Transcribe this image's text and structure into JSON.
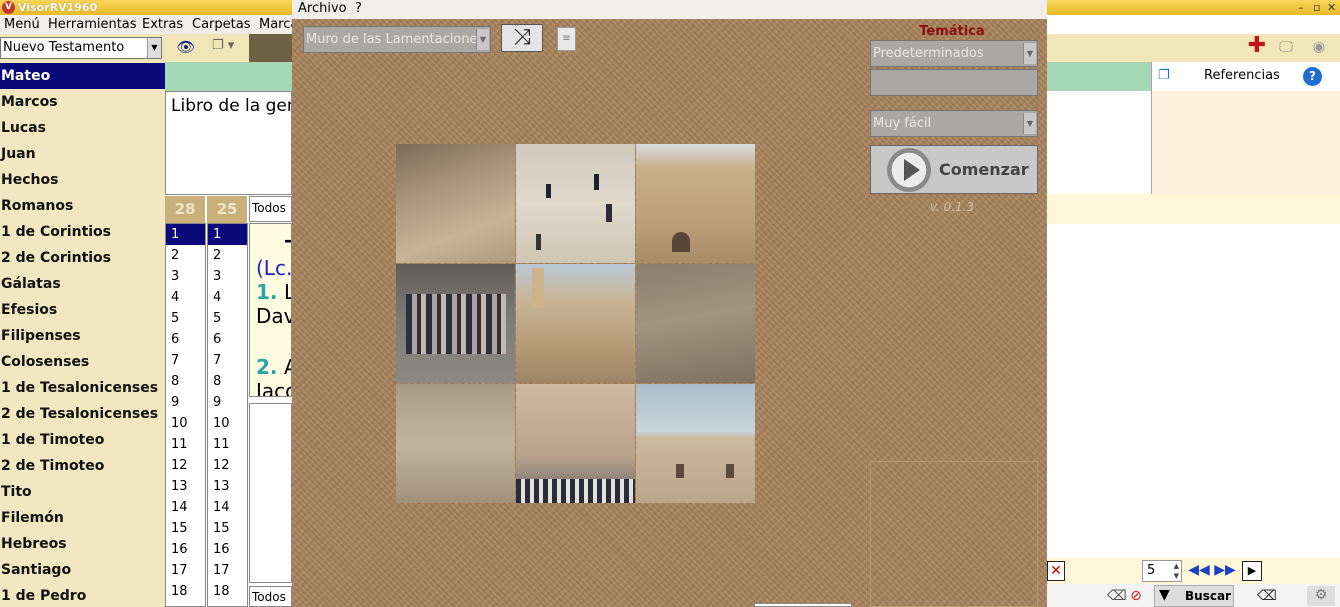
{
  "app": {
    "title": "VisorRV1960",
    "icon_letter": "V"
  },
  "menubar": [
    "Menú",
    "Herramientas",
    "Extras",
    "Carpetas",
    "Marca"
  ],
  "book_selector": {
    "value": "Nuevo Testamento"
  },
  "books": [
    "Mateo",
    "Marcos",
    "Lucas",
    "Juan",
    "Hechos",
    "Romanos",
    "1 de Corintios",
    "2 de Corintios",
    "Gálatas",
    "Efesios",
    "Filipenses",
    "Colosenses",
    "1 de Tesalonicenses",
    "2 de Tesalonicenses",
    "1 de Timoteo",
    "2 de Timoteo",
    "Tito",
    "Filemón",
    "Hebreos",
    "Santiago",
    "1 de Pedro"
  ],
  "selected_book": "Mateo",
  "text_preview": "Libro de la gen",
  "chapter_count": "28",
  "verse_count": "25",
  "numbers": [
    "1",
    "2",
    "3",
    "4",
    "5",
    "6",
    "7",
    "8",
    "9",
    "10",
    "11",
    "12",
    "13",
    "14",
    "15",
    "16",
    "17",
    "18"
  ],
  "todos_label": "Todos",
  "verses_preview": {
    "lead": "(Lc.",
    "v1_num": "1.",
    "v1_text": "L",
    "v1_cont": "Dav",
    "v2_num": "2.",
    "v2_text": "A",
    "v2_cont": "Jaco",
    "top_mark": "–"
  },
  "references": {
    "label": "Referencias",
    "help": "?"
  },
  "nav": {
    "count": "5"
  },
  "search": {
    "label": "Buscar"
  },
  "dialog": {
    "menu": [
      "Archivo",
      "?"
    ],
    "image_select": "Muro de las Lamentaciones",
    "tematica_label": "Temática",
    "tematica_select": "Predeterminados",
    "difficulty_select": "Muy fácil",
    "start_label": "Comenzar",
    "version": "v. 0.1.3"
  },
  "colors": {
    "selection": "#0a0a7a",
    "sidebar": "#f1e7c0",
    "green_header": "#a7d8b5",
    "tematica": "#8c0d0d",
    "dialog_bg": "#a8845c"
  }
}
